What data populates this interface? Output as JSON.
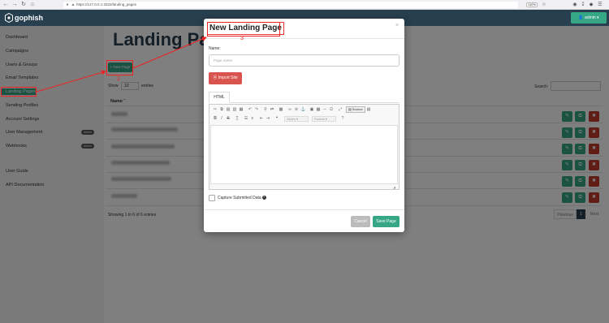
{
  "browser": {
    "url": "https://127.0.0.1:3333/landing_pages",
    "zoom": "110%"
  },
  "app": {
    "brand": "gophish",
    "admin_label": "admin"
  },
  "sidebar": {
    "items": [
      {
        "label": "Dashboard"
      },
      {
        "label": "Campaigns"
      },
      {
        "label": "Users & Groups"
      },
      {
        "label": "Email Templates"
      },
      {
        "label": "Landing Pages"
      },
      {
        "label": "Sending Profiles"
      },
      {
        "label": "Account Settings"
      },
      {
        "label": "User Management",
        "badge": "Admin"
      },
      {
        "label": "Webhooks",
        "badge": "Admin"
      },
      {
        "label": "User Guide"
      },
      {
        "label": "API Documentation"
      }
    ]
  },
  "main": {
    "title": "Landing Pages",
    "new_page_label": "+ New Page",
    "show_label": "Show",
    "show_value": "10",
    "entries_label": "entries",
    "search_label": "Search:",
    "col_name": "Name",
    "showing": "Showing 1 to 6 of 6 entries",
    "pager": {
      "prev": "Previous",
      "current": "1",
      "next": "Next"
    }
  },
  "modal": {
    "title": "New Landing Page",
    "name_label": "Name:",
    "name_placeholder": "Page name",
    "import_label": "Import Site",
    "tab_html": "HTML",
    "styles_label": "Styles",
    "format_label": "Format",
    "source_label": "Source",
    "capture_label": "Capture Submitted Data",
    "cancel_label": "Cancel",
    "save_label": "Save Page"
  },
  "annotations": {
    "n2": "2",
    "n3": "3"
  },
  "colors": {
    "navbar": "#283f50",
    "accent": "#37a684",
    "danger": "#d9534f",
    "annotation": "#ee2222"
  }
}
